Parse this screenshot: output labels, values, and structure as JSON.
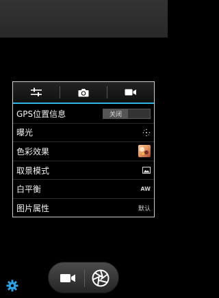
{
  "tabs": [
    {
      "icon": "sliders-icon"
    },
    {
      "icon": "camera-icon"
    },
    {
      "icon": "video-camera-icon"
    }
  ],
  "settings": {
    "gps": {
      "label": "GPS位置信息",
      "value": "关闭"
    },
    "exposure": {
      "label": "曝光"
    },
    "color_effect": {
      "label": "色彩效果"
    },
    "scene_mode": {
      "label": "取景模式"
    },
    "white_balance": {
      "label": "白平衡",
      "value": "AW"
    },
    "picture_props": {
      "label": "图片属性",
      "value": "默认"
    }
  },
  "colors": {
    "accent": "#33b5e5",
    "settings_gear": "#2f9fe2"
  }
}
